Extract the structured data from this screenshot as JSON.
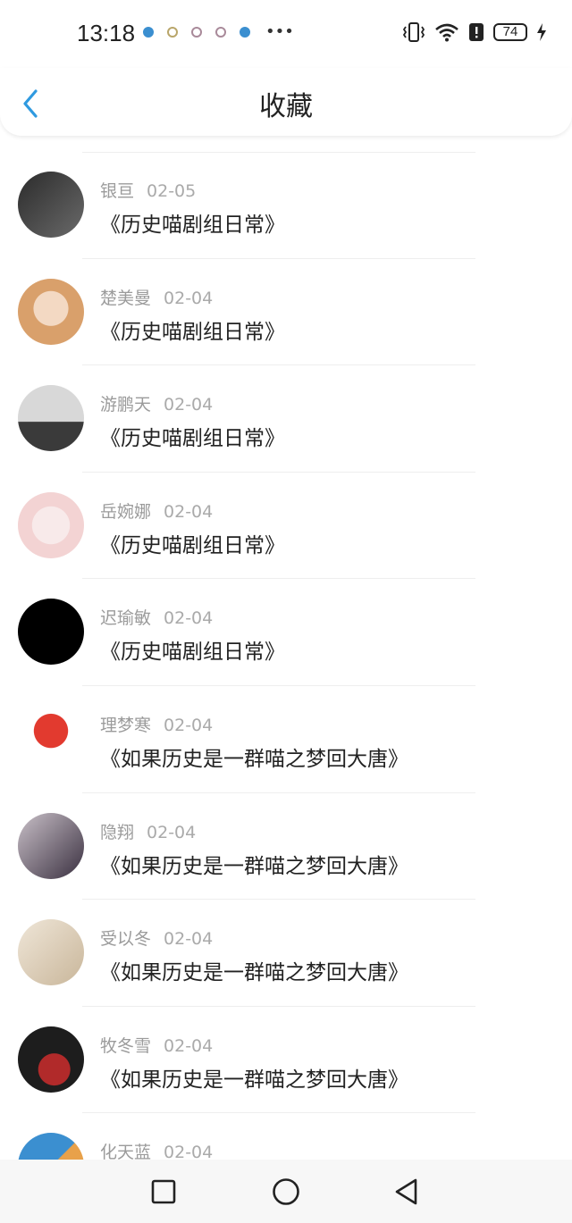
{
  "status": {
    "time": "13:18",
    "battery": "74"
  },
  "header": {
    "title": "收藏"
  },
  "favorites": [
    {
      "name": "银亘",
      "date": "02-05",
      "book": "《历史喵剧组日常》",
      "avatar_colors": [
        "#2b2b2b",
        "#6a6a6a"
      ]
    },
    {
      "name": "楚美曼",
      "date": "02-04",
      "book": "《历史喵剧组日常》",
      "avatar_colors": [
        "#d9a06b",
        "#f3d9c3"
      ]
    },
    {
      "name": "游鹏天",
      "date": "02-04",
      "book": "《历史喵剧组日常》",
      "avatar_colors": [
        "#d8d8d8",
        "#3a3a3a"
      ]
    },
    {
      "name": "岳婉娜",
      "date": "02-04",
      "book": "《历史喵剧组日常》",
      "avatar_colors": [
        "#f3d3d3",
        "#f8eaea"
      ]
    },
    {
      "name": "迟瑜敏",
      "date": "02-04",
      "book": "《历史喵剧组日常》",
      "avatar_colors": [
        "#000000",
        "#111111"
      ]
    },
    {
      "name": "理梦寒",
      "date": "02-04",
      "book": "《如果历史是一群喵之梦回大唐》",
      "avatar_colors": [
        "#e23a2f",
        "#ffffff"
      ]
    },
    {
      "name": "隐翔",
      "date": "02-04",
      "book": "《如果历史是一群喵之梦回大唐》",
      "avatar_colors": [
        "#3a3040",
        "#c9c0c8"
      ]
    },
    {
      "name": "受以冬",
      "date": "02-04",
      "book": "《如果历史是一群喵之梦回大唐》",
      "avatar_colors": [
        "#c9b69a",
        "#efe6d8"
      ]
    },
    {
      "name": "牧冬雪",
      "date": "02-04",
      "book": "《如果历史是一群喵之梦回大唐》",
      "avatar_colors": [
        "#1d1d1d",
        "#b12a2a"
      ]
    },
    {
      "name": "化天蓝",
      "date": "02-04",
      "book": "",
      "avatar_colors": [
        "#3b8fd0",
        "#e8a14a"
      ]
    }
  ],
  "accent_color": "#2f9ae0"
}
